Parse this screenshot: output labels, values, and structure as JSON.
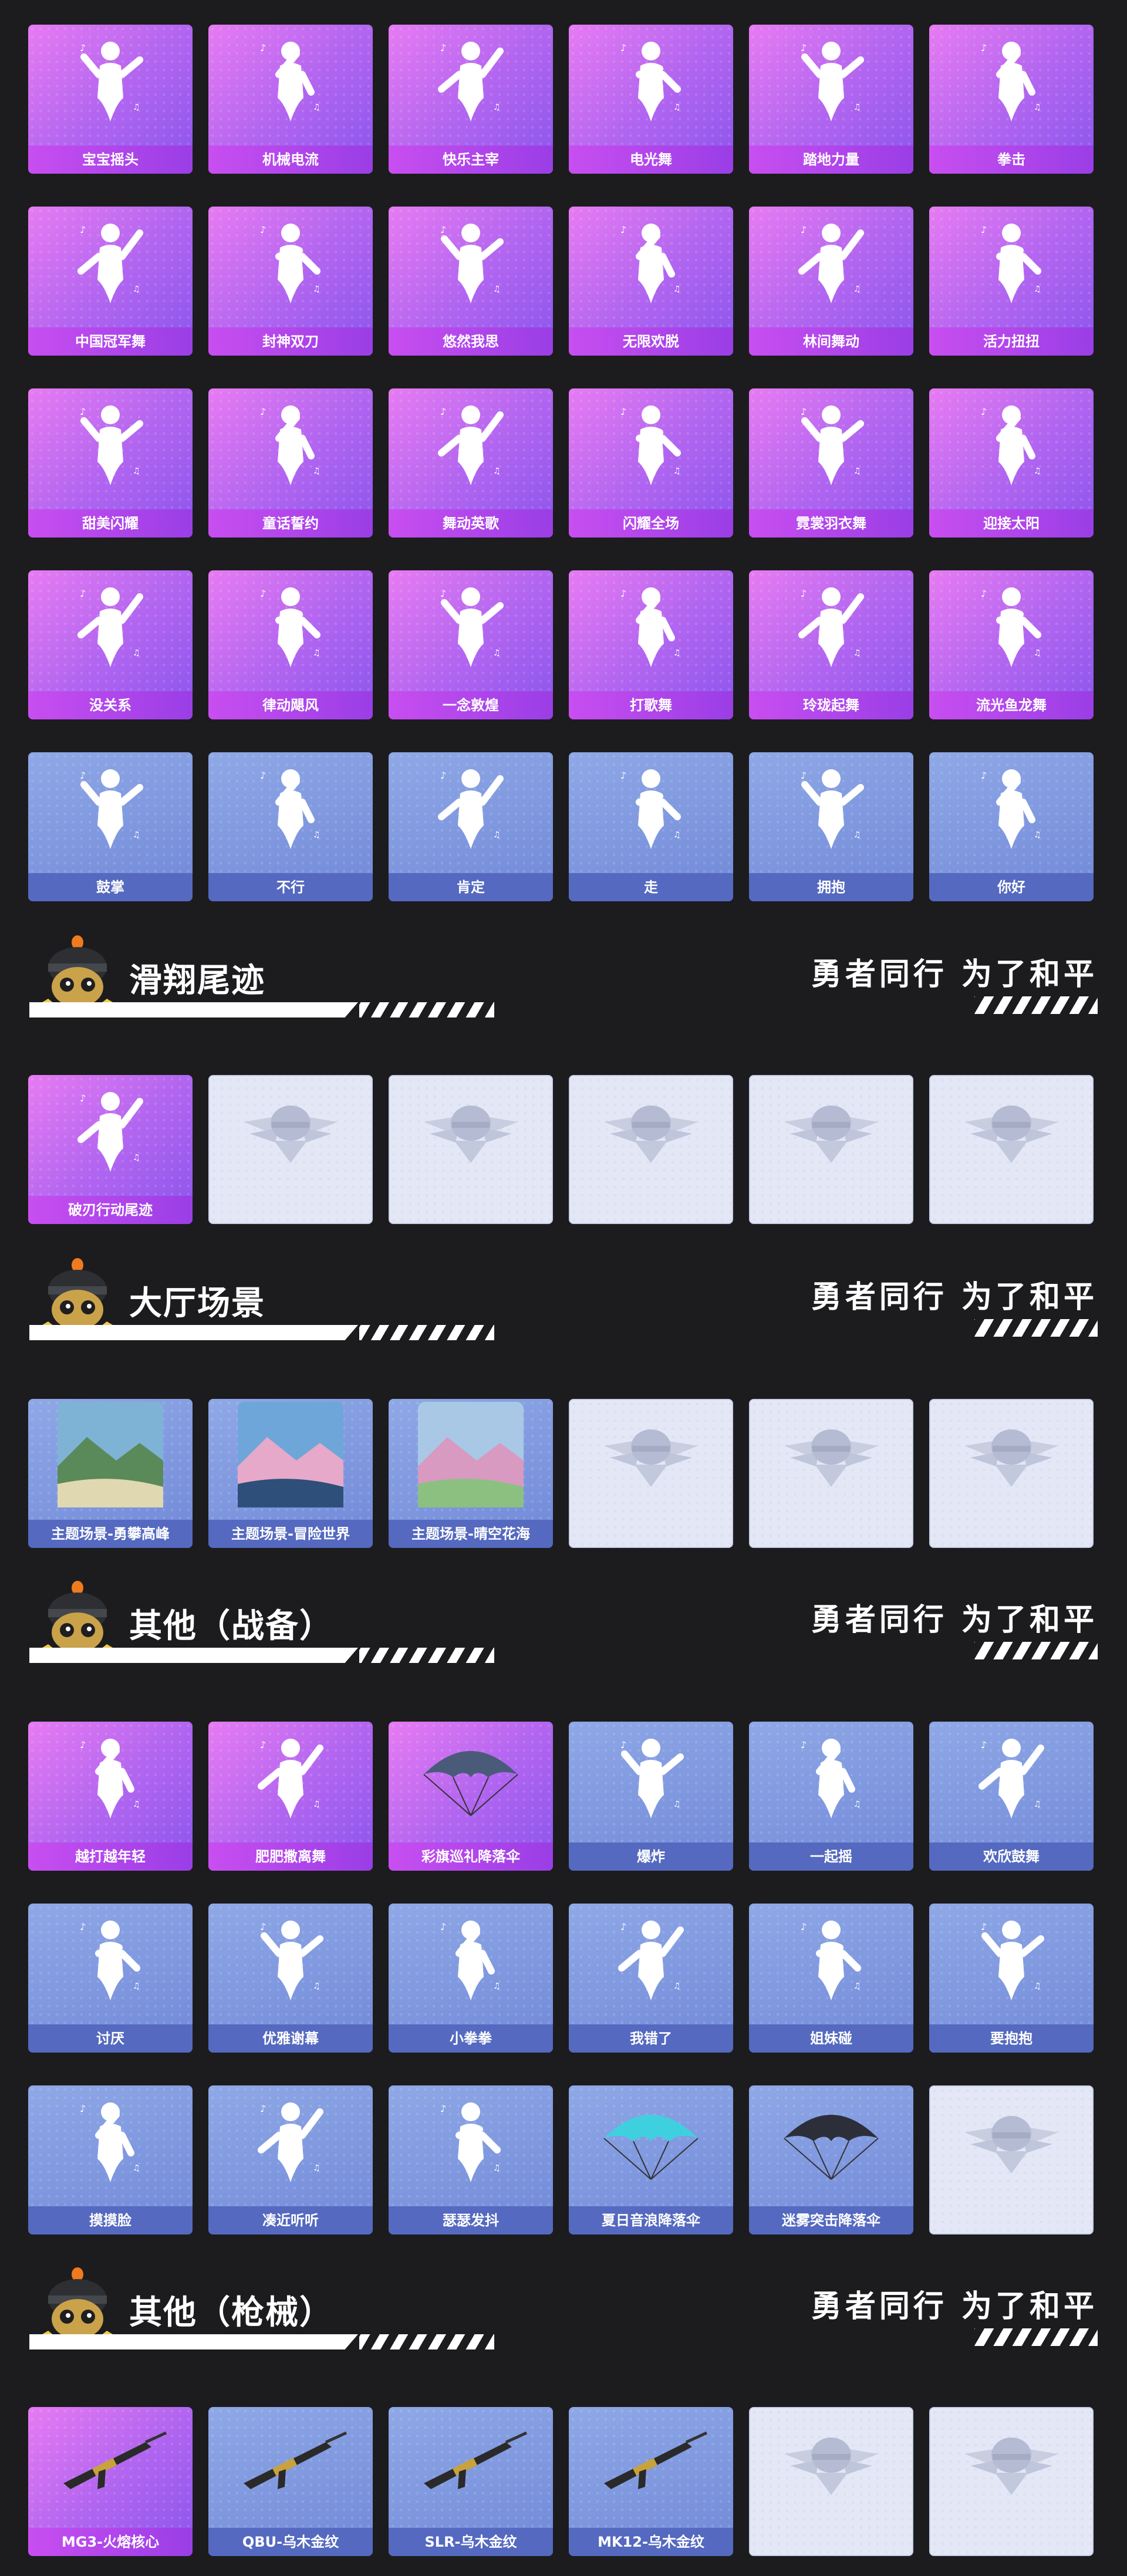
{
  "slogan": "勇者同行 为了和平",
  "sections": [
    {
      "title": "滑翔尾迹"
    },
    {
      "title": "大厅场景"
    },
    {
      "title": "其他（战备）"
    },
    {
      "title": "其他（枪械）"
    }
  ],
  "emotes": [
    [
      "宝宝摇头",
      "机械电流",
      "快乐主宰",
      "电光舞",
      "踏地力量",
      "拳击"
    ],
    [
      "中国冠军舞",
      "封神双刀",
      "悠然我思",
      "无限欢脱",
      "林间舞动",
      "活力扭扭"
    ],
    [
      "甜美闪耀",
      "童话誓约",
      "舞动英歌",
      "闪耀全场",
      "霓裳羽衣舞",
      "迎接太阳"
    ],
    [
      "没关系",
      "律动飓风",
      "一念敦煌",
      "打歌舞",
      "玲珑起舞",
      "流光鱼龙舞"
    ],
    [
      "鼓掌",
      "不行",
      "肯定",
      "走",
      "拥抱",
      "你好"
    ]
  ],
  "trail": [
    "破刃行动尾迹",
    "",
    "",
    "",
    "",
    ""
  ],
  "lobby": [
    "主题场景-勇攀高峰",
    "主题场景-冒险世界",
    "主题场景-晴空花海",
    "",
    "",
    ""
  ],
  "gear": [
    [
      "越打越年轻",
      "肥肥撒离舞",
      "彩旗巡礼降落伞",
      "爆炸",
      "一起摇",
      "欢欣鼓舞"
    ],
    [
      "讨厌",
      "优雅谢幕",
      "小拳拳",
      "我错了",
      "姐妹碰",
      "要抱抱"
    ],
    [
      "摸摸脸",
      "凑近听听",
      "瑟瑟发抖",
      "夏日音浪降落伞",
      "迷雾突击降落伞",
      ""
    ]
  ],
  "guns": [
    "MG3-火熔核心",
    "QBU-乌木金纹",
    "SLR-乌木金纹",
    "MK12-乌木金纹",
    "",
    ""
  ],
  "colors": {
    "purple": "#b366f0",
    "blue": "#7189d8",
    "empty": "#e4e8f6",
    "background": "#1c1c1e"
  }
}
